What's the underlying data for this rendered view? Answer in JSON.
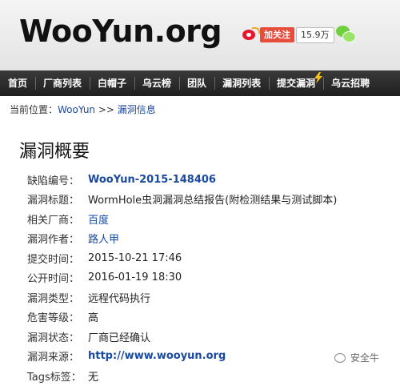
{
  "header": {
    "logo": "WooYun.org",
    "follow_label": "加关注",
    "fans_count": "15.9万"
  },
  "nav": {
    "items": [
      {
        "label": "首页"
      },
      {
        "label": "厂商列表"
      },
      {
        "label": "白帽子"
      },
      {
        "label": "乌云榜"
      },
      {
        "label": "团队"
      },
      {
        "label": "漏洞列表"
      },
      {
        "label": "提交漏洞"
      },
      {
        "label": "乌云招聘"
      }
    ]
  },
  "breadcrumb": {
    "prefix": "当前位置：",
    "home": "WooYun",
    "sep": " >> ",
    "current": "漏洞信息"
  },
  "page": {
    "title": "漏洞概要"
  },
  "details": [
    {
      "key": "缺陷编号：",
      "value": "WooYun-2015-148406"
    },
    {
      "key": "漏洞标题：",
      "value": "WormHole虫洞漏洞总结报告(附检测结果与测试脚本)"
    },
    {
      "key": "相关厂商：",
      "value": "百度"
    },
    {
      "key": "漏洞作者：",
      "value": "路人甲"
    },
    {
      "key": "提交时间：",
      "value": "2015-10-21 17:46"
    },
    {
      "key": "公开时间：",
      "value": "2016-01-19 18:30"
    },
    {
      "key": "漏洞类型：",
      "value": "远程代码执行"
    },
    {
      "key": "危害等级：",
      "value": "高"
    },
    {
      "key": "漏洞状态：",
      "value": "厂商已经确认"
    },
    {
      "key": "漏洞来源：",
      "value": "http://www.wooyun.org"
    },
    {
      "key": "Tags标签：",
      "value": "无"
    }
  ],
  "watermark": "安全牛",
  "colors": {
    "link": "#1a4aa0",
    "nav_bg": "#2a2a2a",
    "weibo_red": "#e6162d",
    "follow_bg": "#e84c3d"
  }
}
